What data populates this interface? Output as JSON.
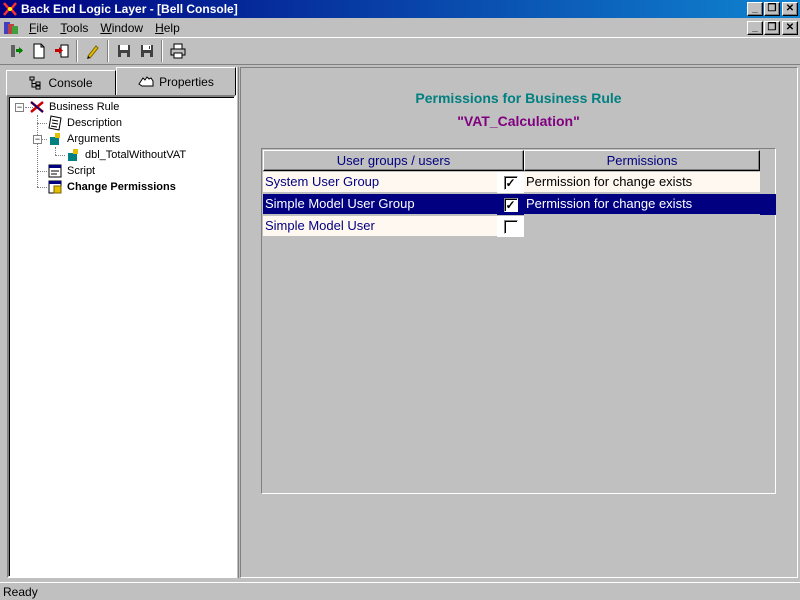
{
  "window": {
    "title": "Back End Logic Layer - [Bell Console]",
    "minimize_label": "_",
    "restore_label": "❐",
    "close_label": "✕"
  },
  "menu": {
    "items": [
      {
        "label": "File",
        "accel": "F"
      },
      {
        "label": "Tools",
        "accel": "T"
      },
      {
        "label": "Window",
        "accel": "W"
      },
      {
        "label": "Help",
        "accel": "H"
      }
    ]
  },
  "toolbar": {
    "icons": [
      "connect-icon",
      "new-document-icon",
      "import-icon",
      "edit-icon",
      "save-icon",
      "save-all-icon",
      "print-icon"
    ]
  },
  "left_pane": {
    "tabs": [
      {
        "label": "Console",
        "icon": "console-tree-icon"
      },
      {
        "label": "Properties",
        "icon": "properties-hand-icon"
      }
    ],
    "tree": {
      "root": {
        "label": "Business Rule",
        "expander": "−"
      },
      "description": {
        "label": "Description"
      },
      "arguments": {
        "label": "Arguments",
        "expander": "−"
      },
      "argument_1": {
        "label": "dbl_TotalWithoutVAT"
      },
      "script": {
        "label": "Script"
      },
      "change_permissions": {
        "label": "Change Permissions"
      }
    }
  },
  "main": {
    "title": "Permissions for Business Rule",
    "subtitle": "\"VAT_Calculation\"",
    "grid": {
      "headers": {
        "users": "User groups / users",
        "permissions": "Permissions"
      },
      "rows": [
        {
          "name": "System User Group",
          "checked": true,
          "check_mark": "✓",
          "permission": "Permission for change exists"
        },
        {
          "name": "Simple Model User Group",
          "checked": true,
          "check_mark": "✓",
          "permission": "Permission for change exists"
        },
        {
          "name": "Simple Model User",
          "checked": false,
          "check_mark": "",
          "permission": ""
        }
      ]
    }
  },
  "status": {
    "text": "Ready"
  },
  "colors": {
    "title_blue": "#000080",
    "heading_teal": "#008080",
    "subtitle_purple": "#800080",
    "selection": "#000080"
  }
}
